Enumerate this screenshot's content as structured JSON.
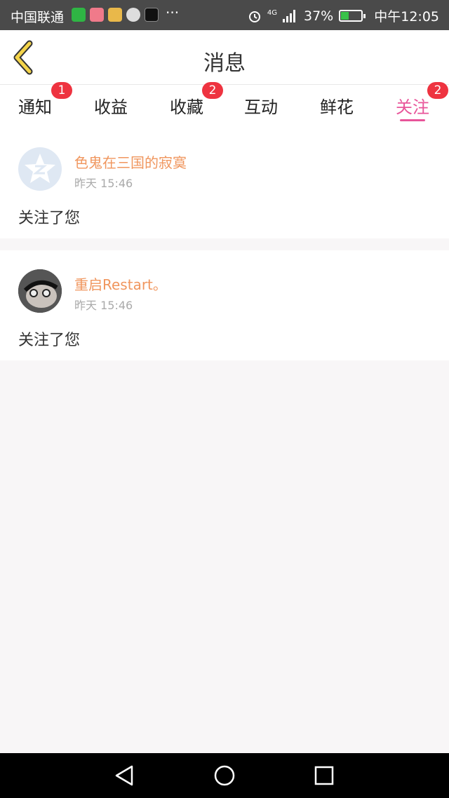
{
  "status_bar": {
    "carrier": "中国联通",
    "battery_pct": "37%",
    "network": "4G",
    "time": "中午12:05",
    "app_icons": [
      "iqiyi-icon",
      "app-icon-pink",
      "app-icon-yellow",
      "message-bubble-icon",
      "tiktok-icon"
    ],
    "more": "···"
  },
  "header": {
    "title": "消息"
  },
  "tabs": [
    {
      "label": "通知",
      "badge": "1"
    },
    {
      "label": "收益",
      "badge": ""
    },
    {
      "label": "收藏",
      "badge": "2"
    },
    {
      "label": "互动",
      "badge": ""
    },
    {
      "label": "鲜花",
      "badge": ""
    },
    {
      "label": "关注",
      "badge": "2",
      "active": true
    }
  ],
  "messages": [
    {
      "user": "色鬼在三国的寂寞",
      "time": "昨天 15:46",
      "text": "关注了您",
      "avatar": "qzone-default-avatar"
    },
    {
      "user": "重启Restart。",
      "time": "昨天 15:46",
      "text": "关注了您",
      "avatar": "photo-avatar"
    }
  ],
  "colors": {
    "accent": "#e8559a",
    "username": "#f0965e",
    "badge": "#ee3340"
  }
}
